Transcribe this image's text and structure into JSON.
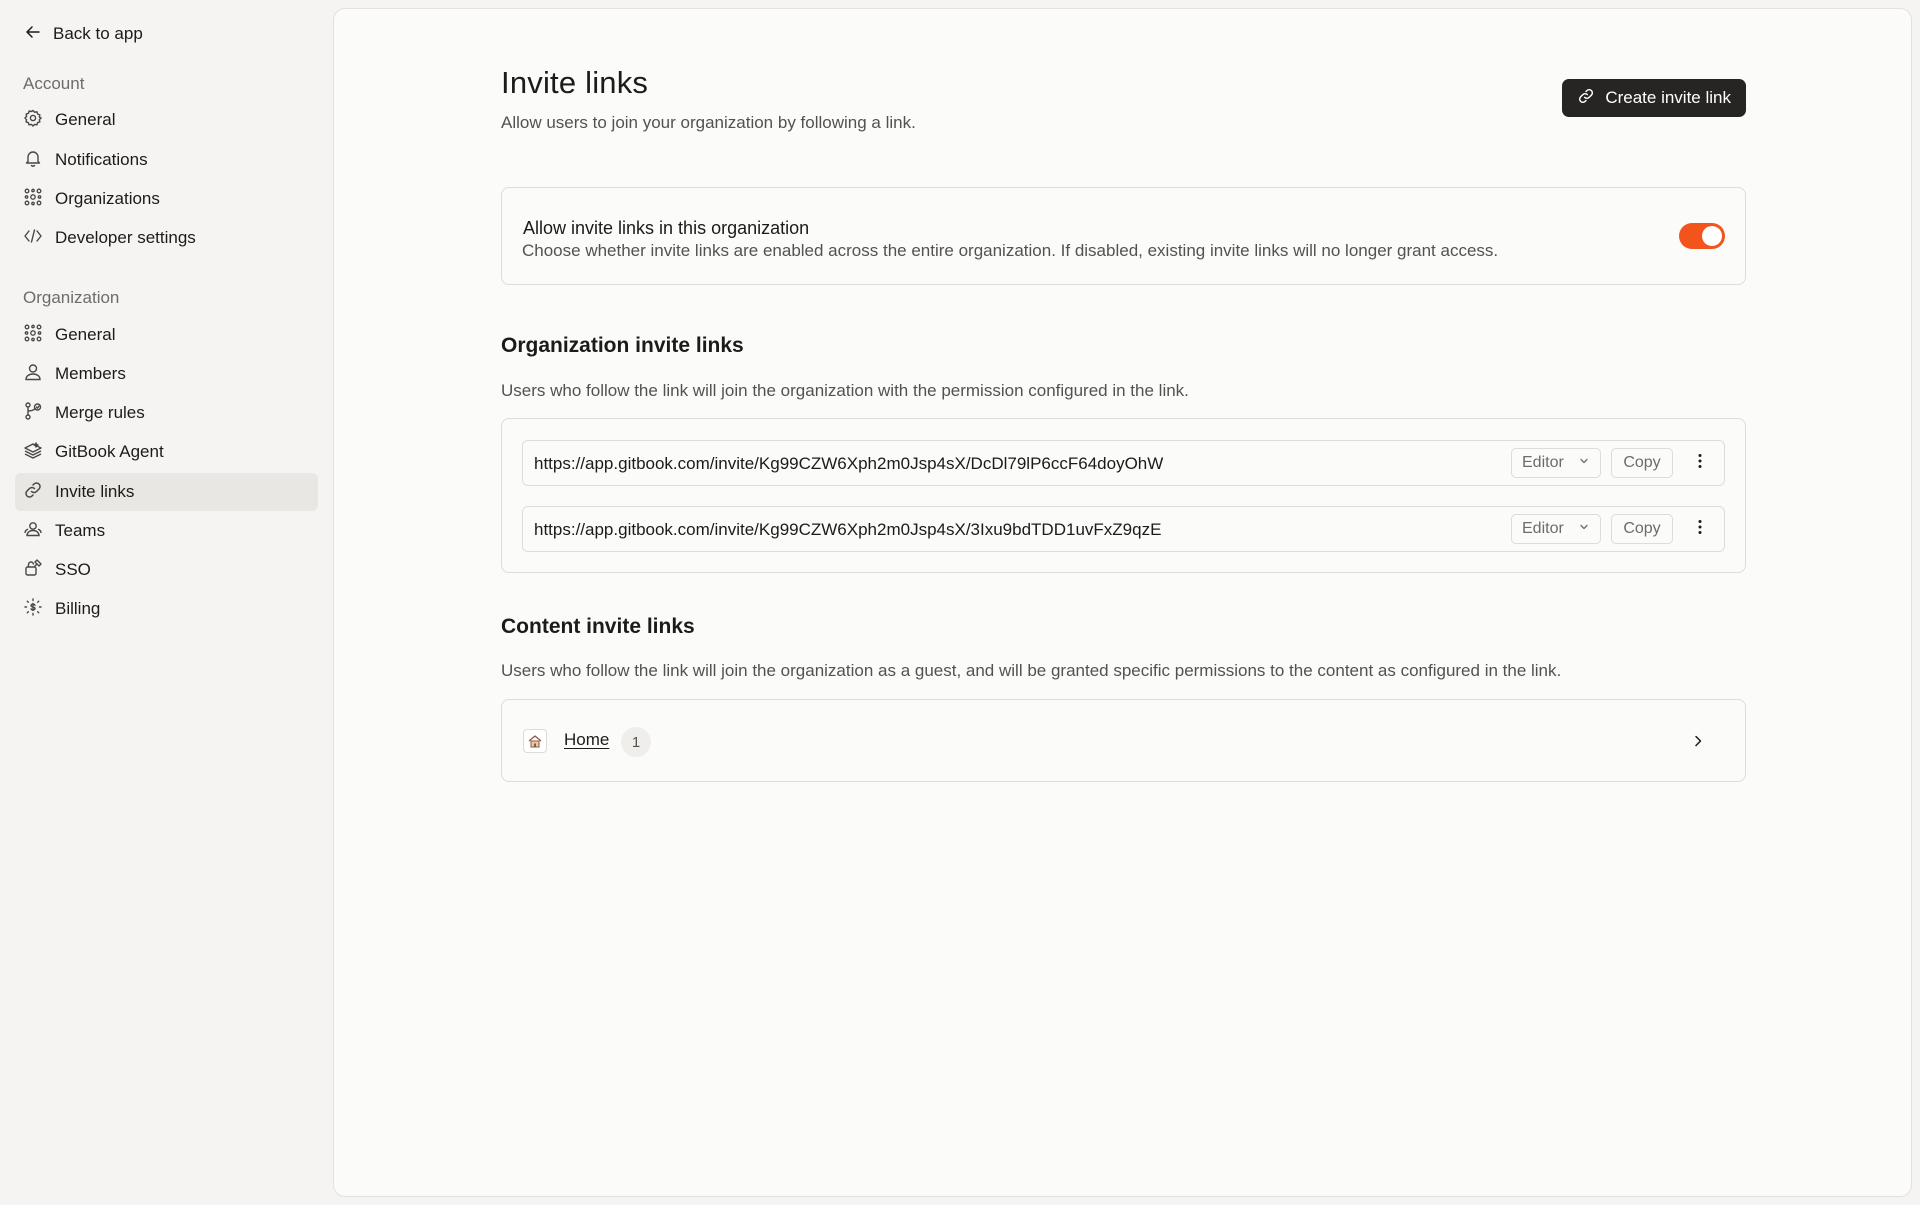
{
  "sidebar": {
    "back_label": "Back to app",
    "account_label": "Account",
    "account_items": [
      {
        "label": "General",
        "icon": "gear-icon"
      },
      {
        "label": "Notifications",
        "icon": "bell-icon"
      },
      {
        "label": "Organizations",
        "icon": "organizations-icon"
      },
      {
        "label": "Developer settings",
        "icon": "code-icon"
      }
    ],
    "organization_label": "Organization",
    "organization_items": [
      {
        "label": "General",
        "icon": "organizations-icon"
      },
      {
        "label": "Members",
        "icon": "members-icon"
      },
      {
        "label": "Merge rules",
        "icon": "merge-icon"
      },
      {
        "label": "GitBook Agent",
        "icon": "agent-icon"
      },
      {
        "label": "Invite links",
        "icon": "link-icon",
        "active": true
      },
      {
        "label": "Teams",
        "icon": "teams-icon"
      },
      {
        "label": "SSO",
        "icon": "sso-icon"
      },
      {
        "label": "Billing",
        "icon": "billing-icon"
      }
    ]
  },
  "header": {
    "title": "Invite links",
    "subtitle": "Allow users to join your organization by following a link.",
    "create_label": "Create invite link"
  },
  "toggle_setting": {
    "title": "Allow invite links in this organization",
    "description": "Choose whether invite links are enabled across the entire organization. If disabled, existing invite links will no longer grant access.",
    "enabled": true,
    "accent_color": "#f2541b"
  },
  "org_links": {
    "title": "Organization invite links",
    "description": "Users who follow the link will join the organization with the permission configured in the link.",
    "rows": [
      {
        "url": "https://app.gitbook.com/invite/Kg99CZW6Xph2m0Jsp4sX/DcDl79lP6ccF64doyOhW",
        "role": "Editor",
        "copy_label": "Copy"
      },
      {
        "url": "https://app.gitbook.com/invite/Kg99CZW6Xph2m0Jsp4sX/3Ixu9bdTDD1uvFxZ9qzE",
        "role": "Editor",
        "copy_label": "Copy"
      }
    ]
  },
  "content_links": {
    "title": "Content invite links",
    "description": "Users who follow the link will join the organization as a guest, and will be granted specific permissions to the content as configured in the link.",
    "spaces": [
      {
        "name": "Home",
        "count": "1",
        "icon": "home-icon"
      }
    ]
  }
}
